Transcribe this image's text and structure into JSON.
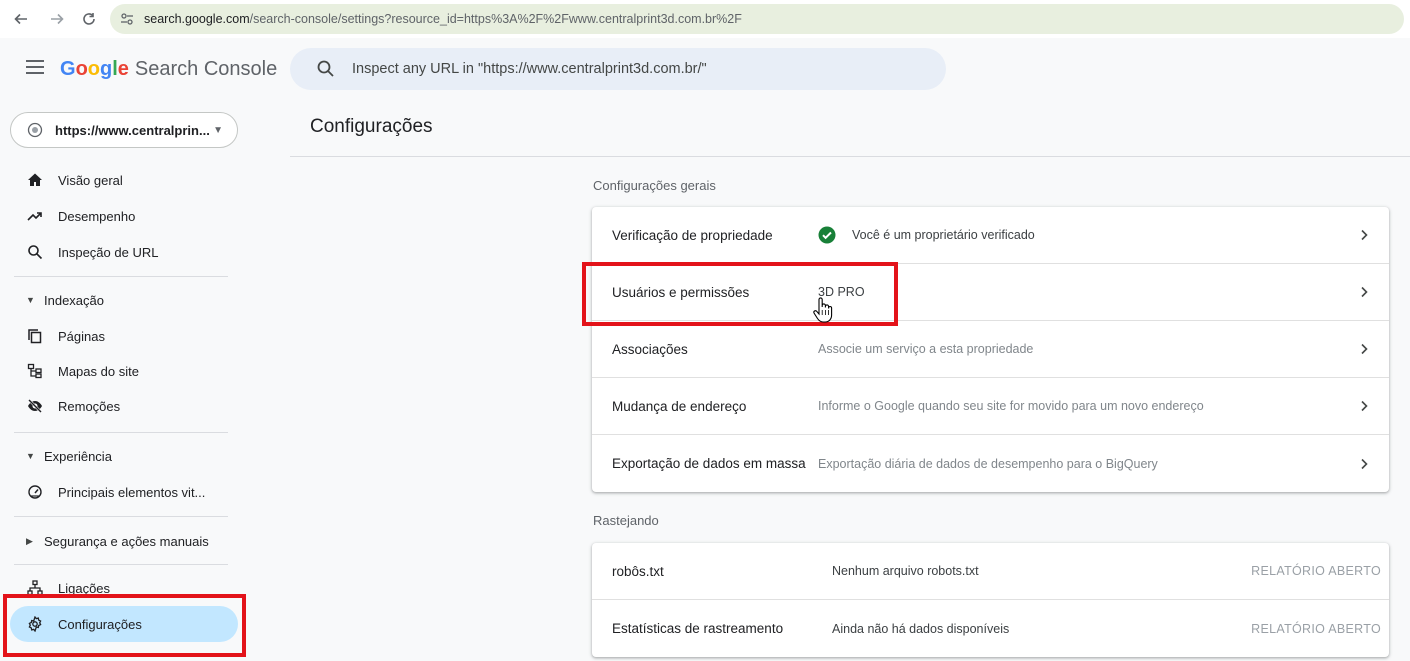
{
  "browser": {
    "url_host": "search.google.com",
    "url_path": "/search-console/settings?resource_id=https%3A%2F%2Fwww.centralprint3d.com.br%2F"
  },
  "header": {
    "brand_google": [
      "G",
      "o",
      "o",
      "g",
      "l",
      "e"
    ],
    "brand_product": "Search Console",
    "search_placeholder": "Inspect any URL in \"https://www.centralprint3d.com.br/\""
  },
  "property": {
    "label": "https://www.centralprin..."
  },
  "sidebar": {
    "items": [
      {
        "label": "Visão geral",
        "icon": "home-icon"
      },
      {
        "label": "Desempenho",
        "icon": "trending-up-icon"
      },
      {
        "label": "Inspeção de URL",
        "icon": "search-icon"
      }
    ],
    "sections": [
      {
        "label": "Indexação",
        "items": [
          {
            "label": "Páginas",
            "icon": "pages-icon"
          },
          {
            "label": "Mapas do site",
            "icon": "sitemap-icon"
          },
          {
            "label": "Remoções",
            "icon": "visibility-off-icon"
          }
        ]
      },
      {
        "label": "Experiência",
        "items": [
          {
            "label": "Principais elementos vit...",
            "icon": "speed-icon"
          }
        ]
      },
      {
        "label": "Segurança e ações manuais",
        "items": []
      }
    ],
    "bottom": [
      {
        "label": "Ligações",
        "icon": "links-icon"
      },
      {
        "label": "Configurações",
        "icon": "gear-icon"
      }
    ]
  },
  "main": {
    "title": "Configurações",
    "general": {
      "label": "Configurações gerais",
      "rows": [
        {
          "label": "Verificação de propriedade",
          "value": "Você é um proprietário verificado"
        },
        {
          "label": "Usuários e permissões",
          "value": "3D PRO"
        },
        {
          "label": "Associações",
          "value": "Associe um serviço a esta propriedade"
        },
        {
          "label": "Mudança de endereço",
          "value": "Informe o Google quando seu site for movido para um novo endereço"
        },
        {
          "label": "Exportação de dados em massa",
          "value": "Exportação diária de dados de desempenho para o BigQuery"
        }
      ]
    },
    "crawling": {
      "label": "Rastejando",
      "rows": [
        {
          "label": "robôs.txt",
          "value": "Nenhum arquivo robots.txt",
          "link": "RELATÓRIO ABERTO"
        },
        {
          "label": "Estatísticas de rastreamento",
          "value": "Ainda não há dados disponíveis",
          "link": "RELATÓRIO ABERTO"
        }
      ]
    }
  },
  "colors": {
    "google_blue": "#4285f4",
    "google_red": "#ea4335",
    "google_yellow": "#fbbc05",
    "google_green": "#34a853",
    "active_nav": "#c2e7ff",
    "highlight_red": "#e3131a",
    "verified_green": "#188038"
  }
}
